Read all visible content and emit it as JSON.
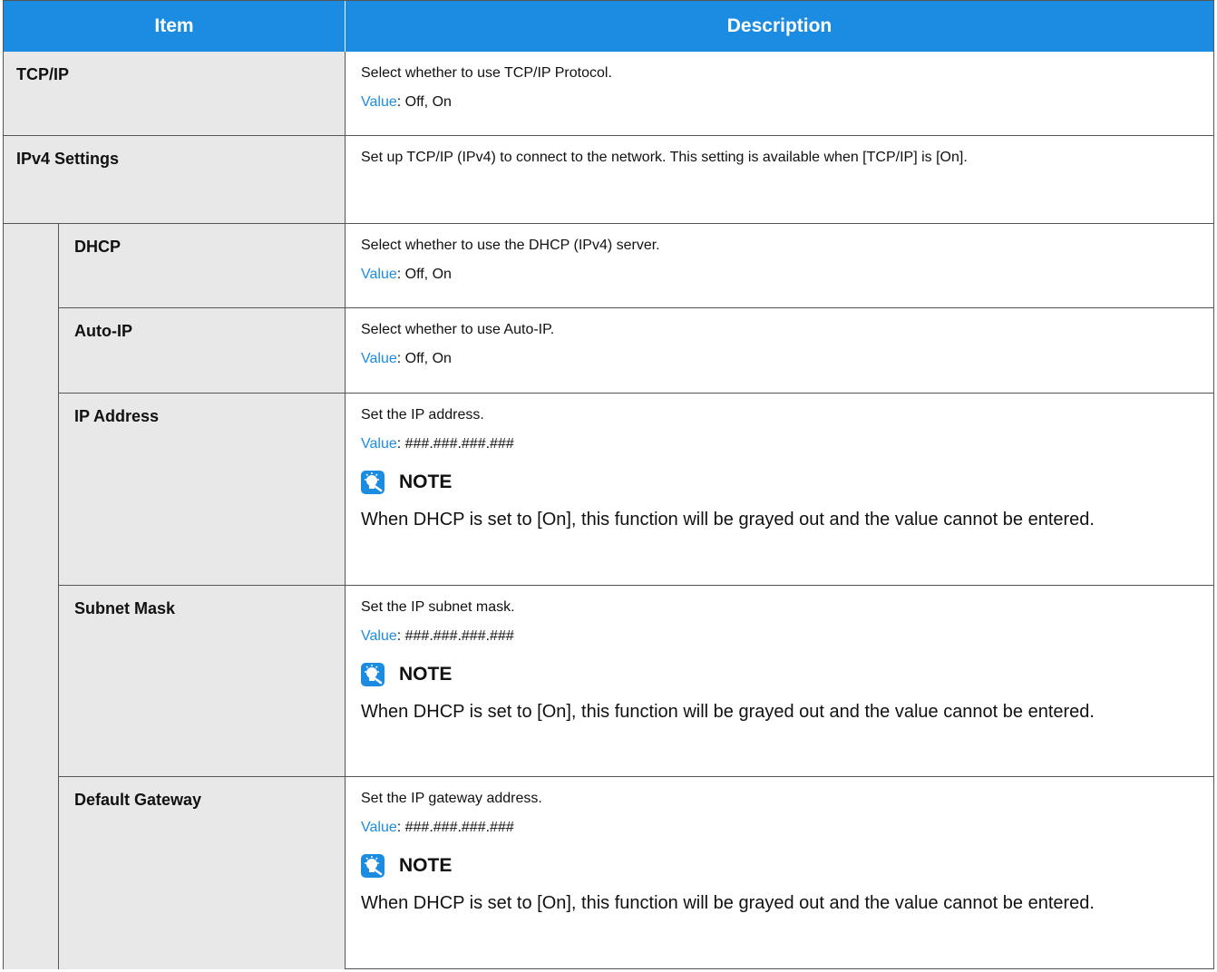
{
  "header": {
    "item": "Item",
    "description": "Description"
  },
  "rows": [
    {
      "name": "TCP/IP",
      "desc": "Select whether to use TCP/IP Protocol.",
      "value_label": "Value",
      "value": ": Off, On"
    },
    {
      "name": "IPv4 Settings",
      "desc": "Set up TCP/IP (IPv4) to connect to the network. This setting is available when [TCP/IP] is [On]."
    },
    {
      "name": "DHCP",
      "desc": "Select whether to use the DHCP (IPv4) server.",
      "value_label": "Value",
      "value": ": Off, On"
    },
    {
      "name": "Auto-IP",
      "desc": "Select whether to use Auto-IP.",
      "value_label": "Value",
      "value": ": Off, On"
    },
    {
      "name": "IP Address",
      "desc": "Set the IP address.",
      "value_label": "Value",
      "value": ": ###.###.###.###",
      "note_title": "NOTE",
      "note_text": "When DHCP is set to [On], this function will be grayed out and the value cannot be entered."
    },
    {
      "name": "Subnet Mask",
      "desc": "Set the IP subnet mask.",
      "value_label": "Value",
      "value": ": ###.###.###.###",
      "note_title": "NOTE",
      "note_text": "When DHCP is set to [On], this function will be grayed out and the value cannot be entered."
    },
    {
      "name": "Default Gateway",
      "desc": "Set the IP gateway address.",
      "value_label": "Value",
      "value": ": ###.###.###.###",
      "note_title": "NOTE",
      "note_text": "When DHCP is set to [On], this function will be grayed out and the value cannot be entered."
    }
  ],
  "colors": {
    "header_bg": "#1c8ce3",
    "item_bg": "#e8e8e8",
    "value_label": "#1c8ce3"
  },
  "icons": {
    "note": "lightbulb-note-icon"
  }
}
